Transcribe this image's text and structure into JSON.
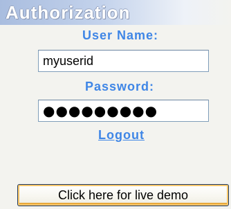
{
  "panel": {
    "title": "Authorization"
  },
  "form": {
    "username_label": "User Name:",
    "username_value": "myuserid",
    "password_label": "Password:",
    "password_masked": "●●●●●●●●●",
    "logout_label": "Logout"
  },
  "demo_button": {
    "label": "Click here for live demo"
  },
  "colors": {
    "label_blue": "#3f86e6",
    "title_gradient_start": "#a9bddf",
    "button_focus_orange": "#f7c76b"
  }
}
